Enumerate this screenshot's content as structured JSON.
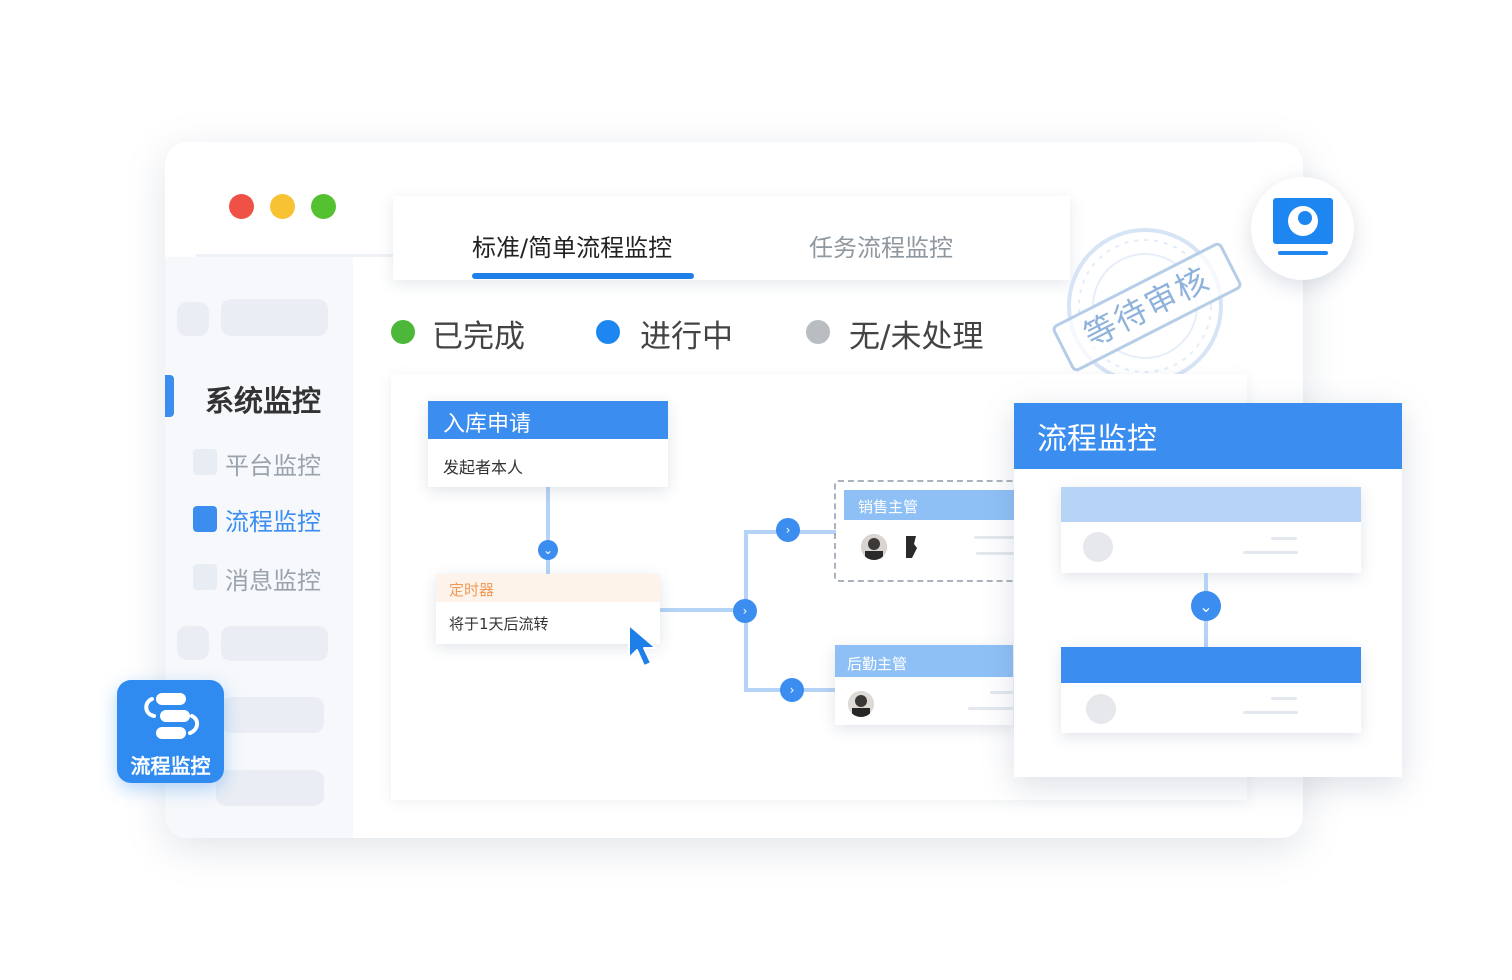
{
  "window": {
    "traffic_lights": [
      {
        "name": "close",
        "color": "#ef5147"
      },
      {
        "name": "minimize",
        "color": "#f7c233"
      },
      {
        "name": "maximize",
        "color": "#54c130"
      }
    ]
  },
  "tabs": [
    {
      "label": "标准/简单流程监控",
      "active": true
    },
    {
      "label": "任务流程监控",
      "active": false
    }
  ],
  "sidebar": {
    "title": "系统监控",
    "items": [
      {
        "label": "平台监控",
        "active": false
      },
      {
        "label": "流程监控",
        "active": true
      },
      {
        "label": "消息监控",
        "active": false
      }
    ]
  },
  "legend": [
    {
      "label": "已完成",
      "color": "#4cb738"
    },
    {
      "label": "进行中",
      "color": "#1e86f0"
    },
    {
      "label": "无/未处理",
      "color": "#b9bcc0"
    }
  ],
  "stamp": {
    "text": "等待审核"
  },
  "flow": {
    "start_node": {
      "title": "入库申请",
      "body": "发起者本人"
    },
    "timer_node": {
      "title": "定时器",
      "body": "将于1天后流转"
    },
    "branch_nodes": [
      {
        "title": "销售主管"
      },
      {
        "title": "后勤主管"
      }
    ]
  },
  "right_panel": {
    "title": "流程监控"
  },
  "app_badge": {
    "label": "流程监控"
  },
  "colors": {
    "accent": "#3b8df0",
    "timer": "#f19b5b"
  }
}
